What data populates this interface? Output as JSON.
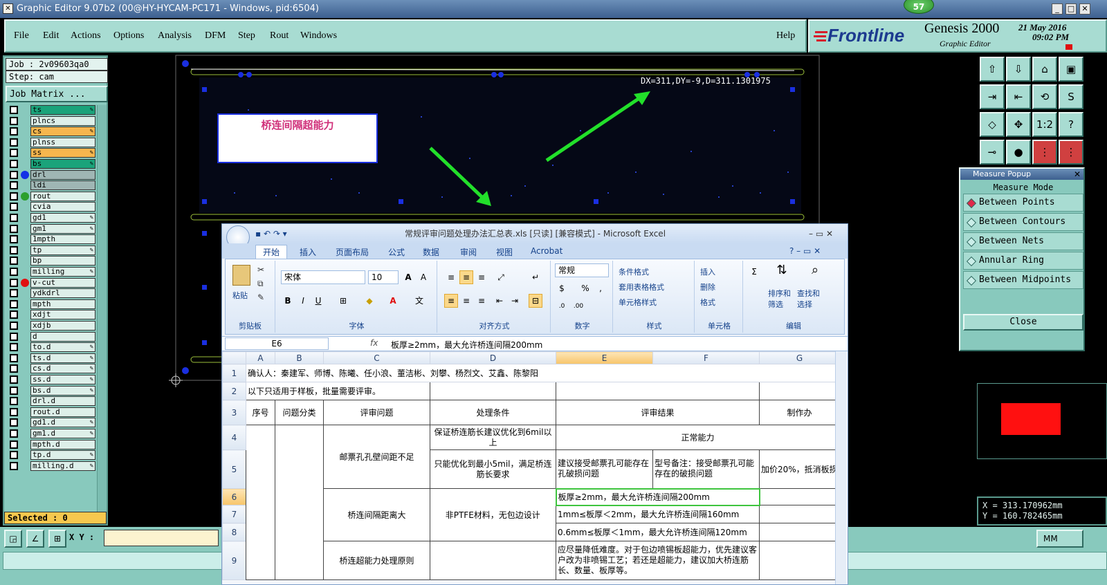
{
  "titlebar": {
    "text": "Graphic Editor 9.07b2 (00@HY-HYCAM-PC171 - Windows, pid:6504)",
    "badge": "57"
  },
  "menu": [
    "File",
    "Edit",
    "Actions",
    "Options",
    "Analysis",
    "DFM",
    "Step",
    "Rout",
    "Windows"
  ],
  "help": "Help",
  "brand": {
    "logo": "Frontline",
    "product": "Genesis 2000",
    "subtitle": "Graphic Editor",
    "date": "21 May 2016",
    "time": "09:02 PM"
  },
  "job": {
    "job_label": "Job : 2v09603qa0",
    "step_label": "Step: cam",
    "matrix_button": "Job Matrix ..."
  },
  "layers": [
    {
      "name": "ts",
      "color": "#1aa37a",
      "pen": true
    },
    {
      "name": "plncs",
      "color": "#ddefe9",
      "pen": false
    },
    {
      "name": "cs",
      "color": "#f6b64e",
      "pen": true
    },
    {
      "name": "plnss",
      "color": "#ddefe9",
      "pen": false
    },
    {
      "name": "ss",
      "color": "#f6b64e",
      "pen": true
    },
    {
      "name": "bs",
      "color": "#1aa37a",
      "pen": true
    },
    {
      "name": "drl",
      "color": "#9fb6b4",
      "pen": false,
      "dot": "#1432e6"
    },
    {
      "name": "ldi",
      "color": "#9fb6b4",
      "pen": false
    },
    {
      "name": "rout",
      "color": "#ddefe9",
      "pen": false,
      "dot": "#2ca02c"
    },
    {
      "name": "cvia",
      "color": "#ddefe9",
      "pen": false
    },
    {
      "name": "gd1",
      "color": "#ddefe9",
      "pen": true
    },
    {
      "name": "gm1",
      "color": "#ddefe9",
      "pen": true
    },
    {
      "name": "1mpth",
      "color": "#ddefe9",
      "pen": false
    },
    {
      "name": "tp",
      "color": "#ddefe9",
      "pen": true
    },
    {
      "name": "bp",
      "color": "#ddefe9",
      "pen": false
    },
    {
      "name": "milling",
      "color": "#ddefe9",
      "pen": true
    },
    {
      "name": "v-cut",
      "color": "#ddefe9",
      "pen": false,
      "dot": "#e01010"
    },
    {
      "name": "ydkdrl",
      "color": "#ddefe9",
      "pen": false
    },
    {
      "name": "mpth",
      "color": "#ddefe9",
      "pen": false
    },
    {
      "name": "xdjt",
      "color": "#ddefe9",
      "pen": false
    },
    {
      "name": "xdjb",
      "color": "#ddefe9",
      "pen": false
    },
    {
      "name": "d",
      "color": "#ddefe9",
      "pen": false
    },
    {
      "name": "to.d",
      "color": "#ddefe9",
      "pen": true
    },
    {
      "name": "ts.d",
      "color": "#ddefe9",
      "pen": true
    },
    {
      "name": "cs.d",
      "color": "#ddefe9",
      "pen": true
    },
    {
      "name": "ss.d",
      "color": "#ddefe9",
      "pen": true
    },
    {
      "name": "bs.d",
      "color": "#ddefe9",
      "pen": true
    },
    {
      "name": "drl.d",
      "color": "#ddefe9",
      "pen": false
    },
    {
      "name": "rout.d",
      "color": "#ddefe9",
      "pen": false
    },
    {
      "name": "gd1.d",
      "color": "#ddefe9",
      "pen": true
    },
    {
      "name": "gm1.d",
      "color": "#ddefe9",
      "pen": true
    },
    {
      "name": "mpth.d",
      "color": "#ddefe9",
      "pen": false
    },
    {
      "name": "tp.d",
      "color": "#ddefe9",
      "pen": true
    },
    {
      "name": "milling.d",
      "color": "#ddefe9",
      "pen": true
    }
  ],
  "selected": "Selected : 0",
  "xy_label": "X Y :",
  "units": "MM",
  "canvas": {
    "measure_readout": "DX=311,DY=-9,D=311.1301975",
    "annotation": "桥连间隔超能力"
  },
  "measure_popup": {
    "title": "Measure Popup",
    "mode_label": "Measure Mode",
    "options": [
      "Between Points",
      "Between Contours",
      "Between Nets",
      "Annular Ring",
      "Between Midpoints"
    ],
    "active": 0,
    "close": "Close"
  },
  "coords": {
    "x": "X = 313.170962mm",
    "y": "Y = 160.782465mm"
  },
  "excel": {
    "title": "常规评审问题处理办法汇总表.xls  [只读]  [兼容模式] - Microsoft Excel",
    "tabs": [
      "开始",
      "插入",
      "页面布局",
      "公式",
      "数据",
      "审阅",
      "视图",
      "Acrobat"
    ],
    "ribbon": {
      "paste": "粘贴",
      "clipboard": "剪贴板",
      "font_name": "宋体",
      "font_size": "10",
      "font_group": "字体",
      "align_group": "对齐方式",
      "number_format": "常规",
      "number_group": "数字",
      "cond_format": "条件格式",
      "table_format": "套用表格格式",
      "cell_style": "单元格样式",
      "style_group": "样式",
      "insert": "插入",
      "delete": "删除",
      "format": "格式",
      "cells_group": "单元格",
      "sort": "排序和\n筛选",
      "find": "查找和\n选择",
      "edit_group": "编辑"
    },
    "name_box": "E6",
    "formula": "板厚≥2mm，最大允许桥连间隔200mm",
    "col_headers": [
      "A",
      "B",
      "C",
      "D",
      "E",
      "F",
      "G"
    ],
    "row1": "确认人：秦建军、师博、陈曦、任小浪、董洁彬、刘攀、杨烈文、艾鑫、陈黎阳",
    "row2": "以下只适用于样板，批量需要评审。",
    "row3": [
      "序号",
      "问题分类",
      "评审问题",
      "处理条件",
      "评审结果",
      "制作办"
    ],
    "c4": "邮票孔孔壁间距不足",
    "d4": "保证桥连筋长建议优化到6mil以上",
    "e4": "正常能力",
    "d5": "只能优化到最小5mil，满足桥连筋长要求",
    "e5": "建议接受邮票孔可能存在孔破损问题",
    "f5": "型号备注：接受邮票孔可能存在的破损问题",
    "g5": "加价20%，抵消板损",
    "c6": "桥连间隔距离大",
    "d6": "非PTFE材料，无包边设计",
    "e6": "板厚≥2mm，最大允许桥连间隔200mm",
    "e7": "1mm≤板厚＜2mm，最大允许桥连间隔160mm",
    "e8": "0.6mm≤板厚＜1mm，最大允许桥连间隔120mm",
    "c9": "桥连超能力处理原则",
    "e9": "应尽量降低难度。对于包边喷锡板超能力，优先建议客户改为非喷锡工艺；若还是超能力，建议加大桥连筋长、数量、板厚等。"
  }
}
